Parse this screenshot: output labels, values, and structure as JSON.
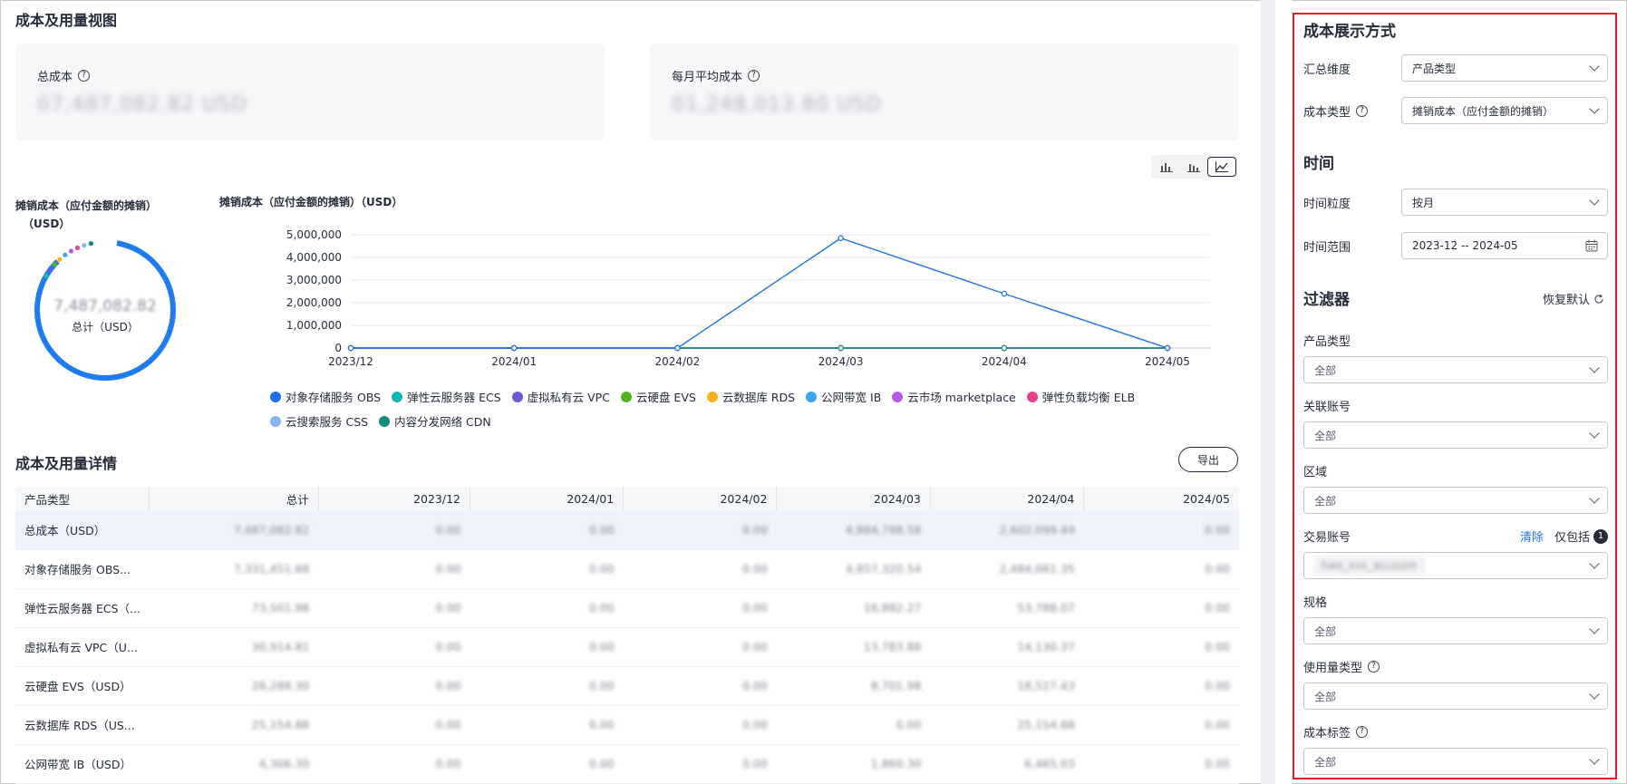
{
  "main": {
    "title": "成本及用量视图",
    "cards": [
      {
        "label": "总成本",
        "value": "07,487,082.82 USD"
      },
      {
        "label": "每月平均成本",
        "value": "01,248,013.80 USD"
      }
    ],
    "chart_types": [
      "bar-chart-icon",
      "stacked-bar-icon",
      "line-chart-icon"
    ],
    "donut": {
      "title": "摊销成本（应付金额的摊销）",
      "unit": "（USD）",
      "total_value": "7,487,082.82",
      "total_label": "总计（USD）"
    },
    "details_title": "成本及用量详情",
    "export_label": "导出"
  },
  "chart_data": {
    "type": "line",
    "title": "摊销成本（应付金额的摊销）（USD）",
    "x": [
      "2023/12",
      "2024/01",
      "2024/02",
      "2024/03",
      "2024/04",
      "2024/05"
    ],
    "yticks": [
      "5,000,000",
      "4,000,000",
      "3,000,000",
      "2,000,000",
      "1,000,000",
      "0"
    ],
    "ylim": [
      0,
      5200000
    ],
    "grid": true,
    "legend_position": "bottom",
    "series": [
      {
        "name": "对象存储服务 OBS",
        "color": "#1e6fe8",
        "values": [
          0,
          0,
          0,
          4850000,
          2400000,
          0
        ]
      },
      {
        "name": "弹性云服务器 ECS",
        "color": "#14b8b0",
        "values": [
          0,
          0,
          0,
          0,
          0,
          0
        ]
      },
      {
        "name": "虚拟私有云 VPC",
        "color": "#6a5ad9",
        "values": [
          0,
          0,
          0,
          0,
          0,
          0
        ]
      },
      {
        "name": "云硬盘 EVS",
        "color": "#52b21f",
        "values": [
          0,
          0,
          0,
          0,
          0,
          0
        ]
      },
      {
        "name": "云数据库 RDS",
        "color": "#f6b21b",
        "values": [
          0,
          0,
          0,
          0,
          0,
          0
        ]
      },
      {
        "name": "公网带宽 IB",
        "color": "#3ba5f0",
        "values": [
          0,
          0,
          0,
          0,
          0,
          0
        ]
      },
      {
        "name": "云市场 marketplace",
        "color": "#b55be3",
        "values": [
          0,
          0,
          0,
          0,
          0,
          0
        ]
      },
      {
        "name": "弹性负载均衡 ELB",
        "color": "#e8408d",
        "values": [
          0,
          0,
          0,
          0,
          0,
          0
        ]
      },
      {
        "name": "云搜索服务 CSS",
        "color": "#86b6f2",
        "values": [
          0,
          0,
          0,
          0,
          0,
          0
        ]
      },
      {
        "name": "内容分发网络 CDN",
        "color": "#0f8a80",
        "values": [
          0,
          0,
          0,
          0,
          0,
          0
        ]
      }
    ]
  },
  "table": {
    "headers": [
      "产品类型",
      "总计",
      "2023/12",
      "2024/01",
      "2024/02",
      "2024/03",
      "2024/04",
      "2024/05"
    ],
    "rows": [
      [
        "总成本（USD）",
        "7,487,082.82",
        "0.00",
        "0.00",
        "0.00",
        "4,884,788.58",
        "2,602,099.44",
        "0.00"
      ],
      [
        "对象存储服务 OBS...",
        "7,331,451.88",
        "0.00",
        "0.00",
        "0.00",
        "4,857,320.54",
        "2,484,081.35",
        "0.00"
      ],
      [
        "弹性云服务器 ECS（...",
        "73,501.98",
        "0.00",
        "0.00",
        "0.00",
        "18,882.27",
        "53,788.07",
        "0.00"
      ],
      [
        "虚拟私有云 VPC（U...",
        "30,914.81",
        "0.00",
        "0.00",
        "0.00",
        "13,783.88",
        "14,130.37",
        "0.00"
      ],
      [
        "云硬盘 EVS（USD）",
        "28,288.30",
        "0.00",
        "0.00",
        "0.00",
        "8,701.98",
        "18,527.43",
        "0.00"
      ],
      [
        "云数据库 RDS（US...",
        "25,154.88",
        "0.00",
        "0.00",
        "0.00",
        "0.00",
        "25,154.88",
        "0.00"
      ],
      [
        "公网带宽 IB（USD）",
        "4,306.30",
        "0.00",
        "0.00",
        "0.00",
        "1,860.30",
        "6,465.03",
        "0.00"
      ]
    ]
  },
  "panel": {
    "display_title": "成本展示方式",
    "summary_dim_label": "汇总维度",
    "summary_dim_value": "产品类型",
    "cost_type_label": "成本类型",
    "cost_type_value": "摊销成本（应付金额的摊销）",
    "time_title": "时间",
    "granularity_label": "时间粒度",
    "granularity_value": "按月",
    "range_label": "时间范围",
    "range_value": "2023-12 -- 2024-05",
    "filter_title": "过滤器",
    "reset_label": "恢复默认",
    "filters": {
      "product_type": {
        "label": "产品类型",
        "value": "全部"
      },
      "linked_account": {
        "label": "关联账号",
        "value": "全部"
      },
      "region": {
        "label": "区域",
        "value": "全部"
      },
      "trade_account": {
        "label": "交易账号",
        "clear": "清除",
        "only": "仅包括",
        "count": "1",
        "chip": "hws_xxx_account"
      },
      "spec": {
        "label": "规格",
        "value": "全部"
      },
      "usage_type": {
        "label": "使用量类型",
        "value": "全部"
      },
      "cost_tag": {
        "label": "成本标签",
        "value": "全部"
      }
    }
  }
}
